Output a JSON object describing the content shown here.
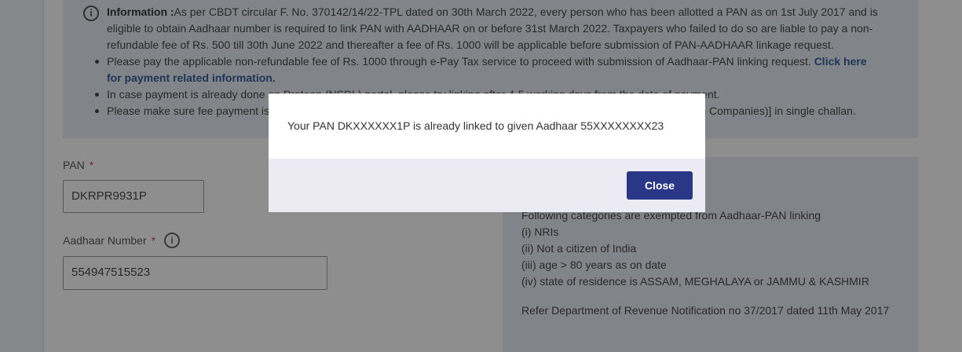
{
  "info": {
    "title": "Information :",
    "intro": "As per CBDT circular F. No. 370142/14/22-TPL dated on 30th March 2022, every person who has been allotted a PAN as on 1st July 2017 and is eligible to obtain Aadhaar number is required to link PAN with AADHAAR on or before 31st March 2022. Taxpayers who failed to do so are liable to pay a non-refundable fee of Rs. 500 till 30th June 2022 and thereafter a fee of Rs. 1000 will be applicable before submission of PAN-AADHAAR linkage request.",
    "bullet1_text": "Please pay the applicable non-refundable fee of Rs. 1000 through e-Pay Tax service to proceed with submission of Aadhaar-PAN linking request. Click here for payment related information.",
    "bullet1_link": "Click here for payment related information.",
    "bullet2_text": "In case payment is already done on Protean (NSDL) portal, please try linking after 4-5 working days from the date of payment.",
    "bullet3_text": "Please make sure fee payment is made for Minor head 500 (Fee for Others) and Major Head 0021 [Income Tax (Other than Companies)] in single challan."
  },
  "form": {
    "pan_label": "PAN",
    "pan_required": "*",
    "pan_value": "DKRPR9931P",
    "aadhaar_label": "Aadhaar Number",
    "aadhaar_required": "*",
    "aadhaar_value": "554947515523",
    "info_glyph": "i"
  },
  "side": {
    "intro": "Following categories are exempted from Aadhaar-PAN linking",
    "items": [
      "(i) NRIs",
      "(ii) Not a citizen of India",
      "(iii) age > 80 years as on date",
      "(iv) state of residence is ASSAM, MEGHALAYA or JAMMU & KASHMIR"
    ],
    "notice": "Refer Department of Revenue Notification no 37/2017 dated 11th May 2017"
  },
  "modal": {
    "message": "Your PAN DKXXXXXX1P is already linked to given Aadhaar 55XXXXXXXX23",
    "close_label": "Close"
  },
  "icons": {
    "info": "info-circle-icon"
  },
  "colors": {
    "primary_button": "#2a3786",
    "link": "#1d4f91",
    "info_bg": "#e4ebf3",
    "required": "#c0392b"
  }
}
